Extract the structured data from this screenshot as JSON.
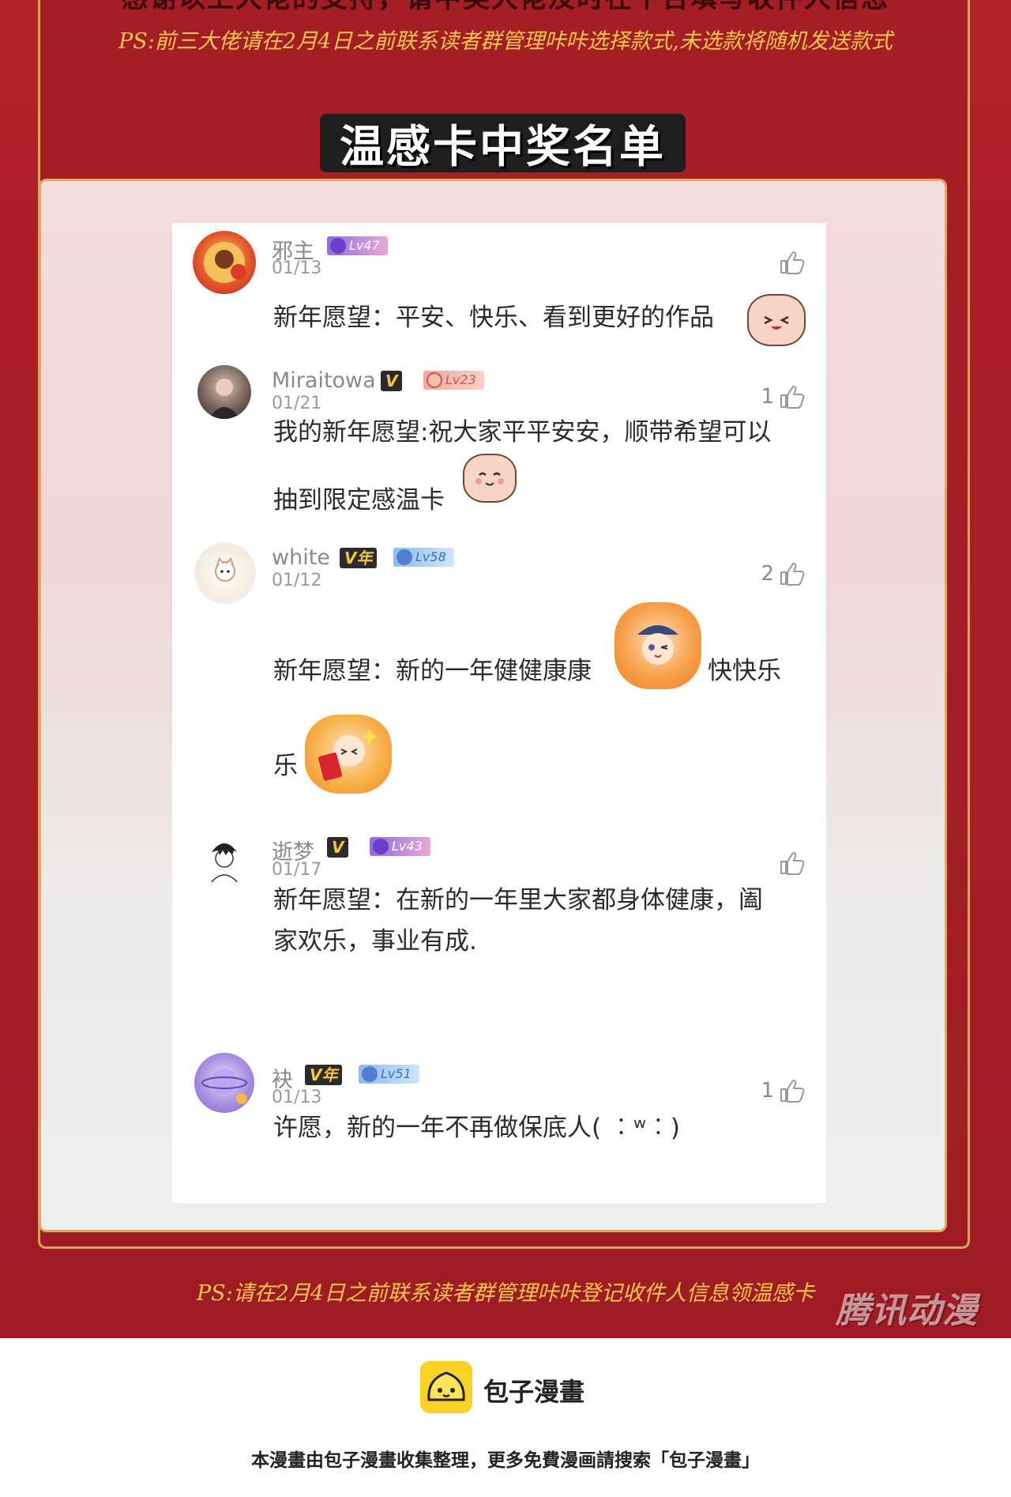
{
  "header": {
    "thanks_line": "感谢以上大佬的支持，请中奖大佬及时在平台填写收件人信息",
    "ps_top": "PS:前三大佬请在2月4日之前联系读者群管理咔咔选择款式,未选款将随机发送款式"
  },
  "banner": {
    "title": "温感卡中奖名单"
  },
  "comments": [
    {
      "username": "邪主",
      "date": "01/13",
      "level": "Lv47",
      "vip": "",
      "likes": "",
      "text_lines": [
        "新年愿望：平安、快乐、看到更好的作品"
      ]
    },
    {
      "username": "Miraitowa",
      "date": "01/21",
      "level": "Lv23",
      "vip": "V",
      "likes": "1",
      "text_lines": [
        "我的新年愿望:祝大家平平安安，顺带希望可以",
        "抽到限定感温卡"
      ]
    },
    {
      "username": "white",
      "date": "01/12",
      "level": "Lv58",
      "vip": "V年",
      "likes": "2",
      "text_lines": [
        "新年愿望：新的一年健健康康",
        "快快乐",
        "乐"
      ]
    },
    {
      "username": "逝梦",
      "date": "01/17",
      "level": "Lv43",
      "vip": "V",
      "likes": "",
      "text_lines": [
        "新年愿望：在新的一年里大家都身体健康，阖",
        "家欢乐，事业有成."
      ]
    },
    {
      "username": "袂",
      "date": "01/13",
      "level": "Lv51",
      "vip": "V年",
      "likes": "1",
      "text_lines": [
        "许愿，新的一年不再做保底人( ︰ʷ︰)"
      ]
    }
  ],
  "ps_bottom": "PS:请在2月4日之前联系读者群管理咔咔登记收件人信息领温感卡",
  "watermark": "腾讯动漫",
  "footer": {
    "brand": "包子漫畫",
    "note": "本漫畫由包子漫畫收集整理，更多免費漫画請搜索「包子漫畫」"
  },
  "colors": {
    "background_red": "#b12128",
    "accent_gold": "#f2c74d",
    "frame_gold": "#e6a861",
    "brand_yellow": "#f9d12a"
  },
  "icons": [
    "thumbs-up-icon",
    "avatar",
    "level-badge",
    "vip-badge",
    "sticker",
    "bun-logo-icon"
  ]
}
